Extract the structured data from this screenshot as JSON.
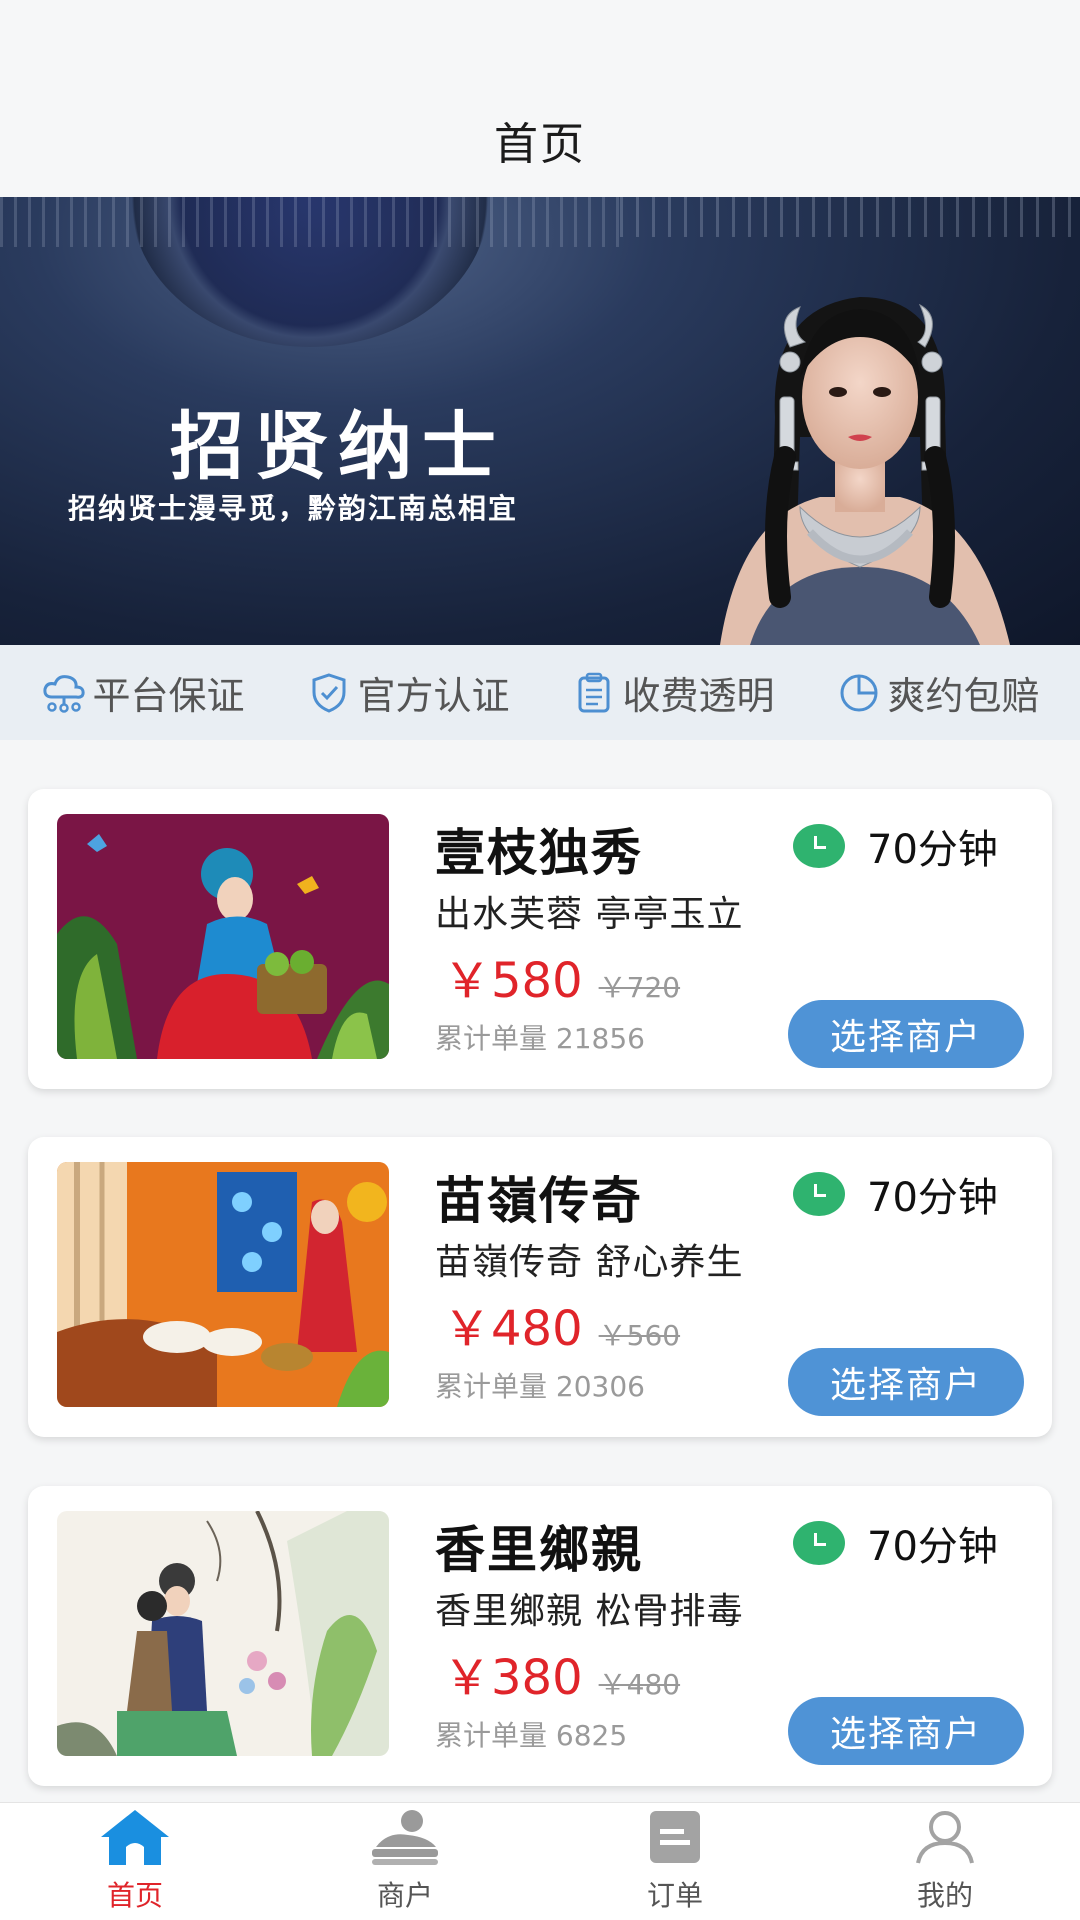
{
  "header": {
    "title": "首页"
  },
  "banner": {
    "title": "招贤纳士",
    "subtitle": "招纳贤士漫寻觅，黔韵江南总相宜"
  },
  "features": [
    {
      "label": "平台保证",
      "icon": "cloud-network-icon"
    },
    {
      "label": "官方认证",
      "icon": "shield-check-icon"
    },
    {
      "label": "收费透明",
      "icon": "clipboard-icon"
    },
    {
      "label": "爽约包赔",
      "icon": "clock-icon"
    }
  ],
  "cards": [
    {
      "name": "壹枝独秀",
      "duration": "70分钟",
      "desc": "出水芙蓉 亭亭玉立",
      "price_now": "￥580",
      "price_old": "￥720",
      "sales": "累计单量 21856",
      "button": "选择商户"
    },
    {
      "name": "苗嶺传奇",
      "duration": "70分钟",
      "desc": "苗嶺传奇 舒心养生",
      "price_now": "￥480",
      "price_old": "￥560",
      "sales": "累计单量 20306",
      "button": "选择商户"
    },
    {
      "name": "香里鄉親",
      "duration": "70分钟",
      "desc": "香里鄉親 松骨排毒",
      "price_now": "￥380",
      "price_old": "￥480",
      "sales": "累计单量 6825",
      "button": "选择商户"
    }
  ],
  "tabbar": [
    {
      "label": "首页",
      "icon": "home-icon",
      "active": true
    },
    {
      "label": "商户",
      "icon": "merchant-icon",
      "active": false
    },
    {
      "label": "订单",
      "icon": "order-icon",
      "active": false
    },
    {
      "label": "我的",
      "icon": "user-icon",
      "active": false
    }
  ],
  "colors": {
    "accent_blue": "#4f93d6",
    "price_red": "#e0242a",
    "duration_green": "#2fb36f",
    "tab_active_blue": "#1a8fe0"
  }
}
